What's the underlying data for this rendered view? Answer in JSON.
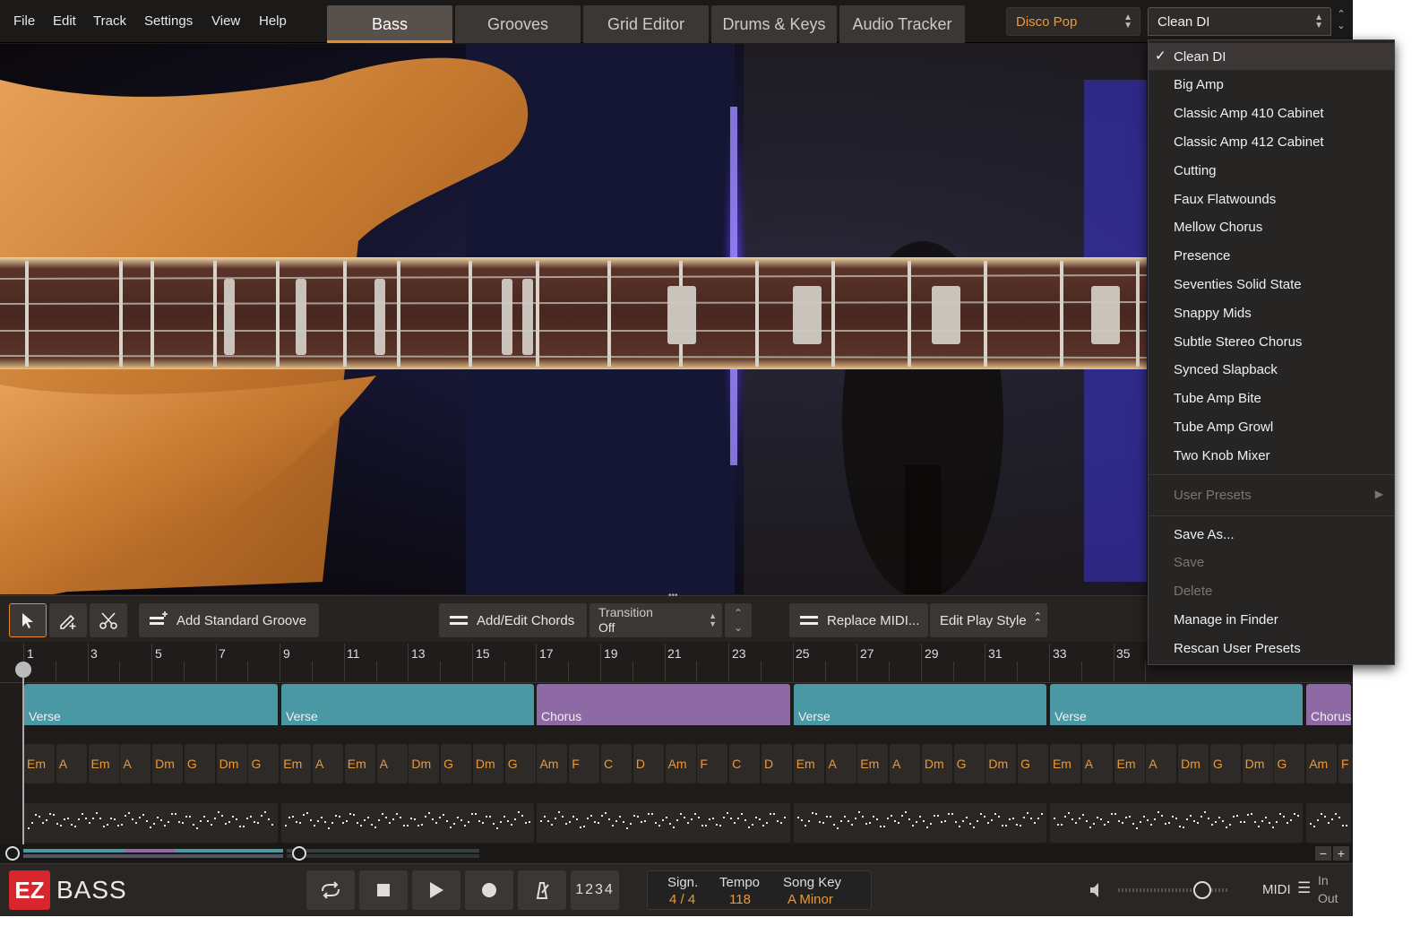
{
  "menubar": [
    "File",
    "Edit",
    "Track",
    "Settings",
    "View",
    "Help"
  ],
  "tabs": [
    {
      "label": "Bass",
      "active": true
    },
    {
      "label": "Grooves",
      "active": false
    },
    {
      "label": "Grid Editor",
      "active": false
    },
    {
      "label": "Drums & Keys",
      "active": false
    },
    {
      "label": "Audio Tracker",
      "active": false
    }
  ],
  "style_select": {
    "value": "Disco Pop"
  },
  "preset_select": {
    "value": "Clean DI"
  },
  "toolbar": {
    "add_standard_groove": "Add Standard Groove",
    "add_edit_chords": "Add/Edit Chords",
    "transition_label": "Transition",
    "transition_value": "Off",
    "replace_midi": "Replace MIDI...",
    "edit_play_style": "Edit Play Style"
  },
  "ruler": [
    "1",
    "3",
    "5",
    "7",
    "9",
    "11",
    "13",
    "15",
    "17",
    "19",
    "21",
    "23",
    "25",
    "27",
    "29",
    "31",
    "33",
    "35"
  ],
  "sections": [
    {
      "label": "Verse",
      "type": "verse"
    },
    {
      "label": "Verse",
      "type": "verse"
    },
    {
      "label": "Chorus",
      "type": "chorus"
    },
    {
      "label": "Verse",
      "type": "verse"
    },
    {
      "label": "Verse",
      "type": "verse"
    },
    {
      "label": "Chorus",
      "type": "chorus"
    }
  ],
  "chords": [
    "Em",
    "A",
    "Em",
    "A",
    "Dm",
    "G",
    "Dm",
    "G",
    "Em",
    "A",
    "Em",
    "A",
    "Dm",
    "G",
    "Dm",
    "G",
    "Am",
    "F",
    "C",
    "D",
    "Am",
    "F",
    "C",
    "D",
    "Em",
    "A",
    "Em",
    "A",
    "Dm",
    "G",
    "Dm",
    "G",
    "Em",
    "A",
    "Em",
    "A",
    "Dm",
    "G",
    "Dm",
    "G",
    "Am",
    "F"
  ],
  "transport": {
    "count_in": "1234",
    "sign_label": "Sign.",
    "sign_value": "4 / 4",
    "tempo_label": "Tempo",
    "tempo_value": "118",
    "songkey_label": "Song Key",
    "songkey_value": "A Minor",
    "midi_label": "MIDI",
    "in_label": "In",
    "out_label": "Out"
  },
  "branding": {
    "ez": "EZ",
    "product": "BASS"
  },
  "dropdown": {
    "items": [
      {
        "label": "Clean DI",
        "selected": true,
        "enabled": true
      },
      {
        "label": "Big Amp",
        "selected": false,
        "enabled": true
      },
      {
        "label": "Classic Amp 410 Cabinet",
        "selected": false,
        "enabled": true
      },
      {
        "label": "Classic Amp 412 Cabinet",
        "selected": false,
        "enabled": true
      },
      {
        "label": "Cutting",
        "selected": false,
        "enabled": true
      },
      {
        "label": "Faux Flatwounds",
        "selected": false,
        "enabled": true
      },
      {
        "label": "Mellow Chorus",
        "selected": false,
        "enabled": true
      },
      {
        "label": "Presence",
        "selected": false,
        "enabled": true
      },
      {
        "label": "Seventies Solid State",
        "selected": false,
        "enabled": true
      },
      {
        "label": "Snappy Mids",
        "selected": false,
        "enabled": true
      },
      {
        "label": "Subtle Stereo Chorus",
        "selected": false,
        "enabled": true
      },
      {
        "label": "Synced Slapback",
        "selected": false,
        "enabled": true
      },
      {
        "label": "Tube Amp Bite",
        "selected": false,
        "enabled": true
      },
      {
        "label": "Tube Amp Growl",
        "selected": false,
        "enabled": true
      },
      {
        "label": "Two Knob Mixer",
        "selected": false,
        "enabled": true
      }
    ],
    "user_presets": "User Presets",
    "actions": [
      {
        "label": "Save As...",
        "enabled": true
      },
      {
        "label": "Save",
        "enabled": false
      },
      {
        "label": "Delete",
        "enabled": false
      },
      {
        "label": "Manage in Finder",
        "enabled": true
      },
      {
        "label": "Rescan User Presets",
        "enabled": true
      }
    ]
  },
  "colors": {
    "accent": "#e78a30",
    "verse": "#4a98a3",
    "chorus": "#8e6aa4",
    "chord_text": "#e89a3c",
    "ez_red": "#d8262e"
  }
}
